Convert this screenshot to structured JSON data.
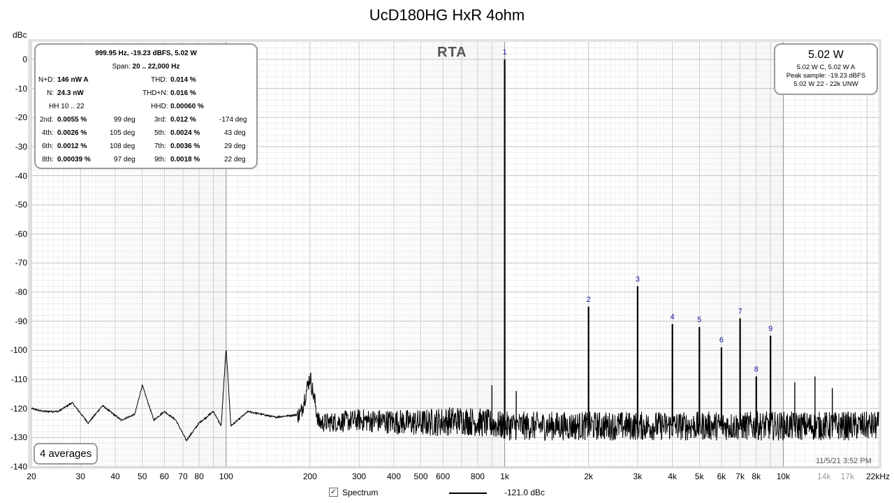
{
  "chart_data": {
    "type": "line",
    "title": "UcD180HG HxR 4ohm",
    "ylabel": "dBc",
    "x_scale": "log",
    "xlim": [
      20,
      22000
    ],
    "ylim": [
      -140,
      10
    ],
    "grid": true,
    "y_ticks": [
      "0",
      "-10",
      "-20",
      "-30",
      "-40",
      "-50",
      "-60",
      "-70",
      "-80",
      "-90",
      "-100",
      "-110",
      "-120",
      "-130",
      "-140"
    ],
    "x_ticks": [
      {
        "v": 20,
        "label": "20"
      },
      {
        "v": 30,
        "label": "30"
      },
      {
        "v": 40,
        "label": "40"
      },
      {
        "v": 50,
        "label": "50"
      },
      {
        "v": 60,
        "label": "60"
      },
      {
        "v": 70,
        "label": "70"
      },
      {
        "v": 80,
        "label": "80"
      },
      {
        "v": 100,
        "label": "100"
      },
      {
        "v": 200,
        "label": "200"
      },
      {
        "v": 300,
        "label": "300"
      },
      {
        "v": 400,
        "label": "400"
      },
      {
        "v": 500,
        "label": "500"
      },
      {
        "v": 600,
        "label": "600"
      },
      {
        "v": 800,
        "label": "800"
      },
      {
        "v": 1000,
        "label": "1k"
      },
      {
        "v": 2000,
        "label": "2k"
      },
      {
        "v": 3000,
        "label": "3k"
      },
      {
        "v": 4000,
        "label": "4k"
      },
      {
        "v": 5000,
        "label": "5k"
      },
      {
        "v": 6000,
        "label": "6k"
      },
      {
        "v": 7000,
        "label": "7k"
      },
      {
        "v": 8000,
        "label": "8k"
      },
      {
        "v": 10000,
        "label": "10k"
      }
    ],
    "x_ticks_minor": [
      {
        "v": 14000,
        "label": "14k"
      },
      {
        "v": 17000,
        "label": "17k"
      },
      {
        "v": 22000,
        "label": "22kHz"
      }
    ],
    "baseline_points": [
      [
        20,
        -120
      ],
      [
        22,
        -121
      ],
      [
        25,
        -121
      ],
      [
        28,
        -118
      ],
      [
        32,
        -125
      ],
      [
        36,
        -119
      ],
      [
        42,
        -124
      ],
      [
        47,
        -122
      ],
      [
        50,
        -112
      ],
      [
        55,
        -124
      ],
      [
        60,
        -121
      ],
      [
        66,
        -124
      ],
      [
        72,
        -131
      ],
      [
        80,
        -125
      ],
      [
        90,
        -121
      ],
      [
        96,
        -126
      ],
      [
        100,
        -99
      ],
      [
        104,
        -126
      ],
      [
        120,
        -121
      ],
      [
        150,
        -123
      ],
      [
        185,
        -122
      ],
      [
        200,
        -109
      ],
      [
        215,
        -125
      ],
      [
        300,
        -124
      ],
      [
        500,
        -125
      ],
      [
        700,
        -124
      ],
      [
        1000,
        -126
      ],
      [
        3000,
        -126
      ],
      [
        10000,
        -126
      ],
      [
        22000,
        -126
      ]
    ],
    "noise_spread_db": [
      6,
      10
    ],
    "peaks": [
      {
        "label": "1",
        "x": 1000,
        "y": 0
      },
      {
        "label": "2",
        "x": 2000,
        "y": -85
      },
      {
        "label": "3",
        "x": 3000,
        "y": -78
      },
      {
        "label": "4",
        "x": 4000,
        "y": -91
      },
      {
        "label": "5",
        "x": 5000,
        "y": -92
      },
      {
        "label": "6",
        "x": 6000,
        "y": -99
      },
      {
        "label": "7",
        "x": 7000,
        "y": -89
      },
      {
        "label": "8",
        "x": 8000,
        "y": -109
      },
      {
        "label": "9",
        "x": 9000,
        "y": -95
      }
    ],
    "spurs": [
      {
        "x": 900,
        "y": -112
      },
      {
        "x": 1100,
        "y": -114
      },
      {
        "x": 11000,
        "y": -111
      },
      {
        "x": 13000,
        "y": -109
      },
      {
        "x": 15000,
        "y": -113
      }
    ],
    "series": [
      {
        "name": "Spectrum",
        "legend_value": "-121.0 dBc",
        "color": "#000000"
      }
    ]
  },
  "overlay": {
    "rta_label": "RTA",
    "info": {
      "header": "999.95 Hz, -19.23 dBFS, 5.02 W",
      "span_label": "Span:",
      "span_value": "20 .. 22,000 Hz",
      "nd_label": "N+D:",
      "nd_value": "146 nW A",
      "thd_label": "THD:",
      "thd_value": "0.014 %",
      "n_label": "N:",
      "n_value": "24.3 nW",
      "thdn_label": "THD+N:",
      "thdn_value": "0.016 %",
      "hh_label": "HH 10 .. 22",
      "hhd_label": "HHD:",
      "hhd_value": "0.00060 %",
      "harmonics": [
        {
          "l1": "2nd:",
          "v1": "0.0055 %",
          "d1": "99 deg",
          "l2": "3rd:",
          "v2": "0.012 %",
          "d2": "-174 deg"
        },
        {
          "l1": "4th:",
          "v1": "0.0026 %",
          "d1": "105 deg",
          "l2": "5th:",
          "v2": "0.0024 %",
          "d2": "43 deg"
        },
        {
          "l1": "6th:",
          "v1": "0.0012 %",
          "d1": "108 deg",
          "l2": "7th:",
          "v2": "0.0036 %",
          "d2": "29 deg"
        },
        {
          "l1": "8th:",
          "v1": "0.00039 %",
          "d1": "97 deg",
          "l2": "9th:",
          "v2": "0.0018 %",
          "d2": "22 deg"
        }
      ]
    },
    "power": {
      "big": "5.02 W",
      "line1": "5.02 W C, 5.02 W A",
      "line2": "Peak sample: -19.23 dBFS",
      "line3": "5.02 W 22 - 22k UNW"
    },
    "averages": "4 averages",
    "timestamp": "11/5/21 3:52 PM"
  },
  "legend": {
    "checkbox_mark": "✓",
    "series_label": "Spectrum",
    "value": "-121.0 dBc"
  }
}
